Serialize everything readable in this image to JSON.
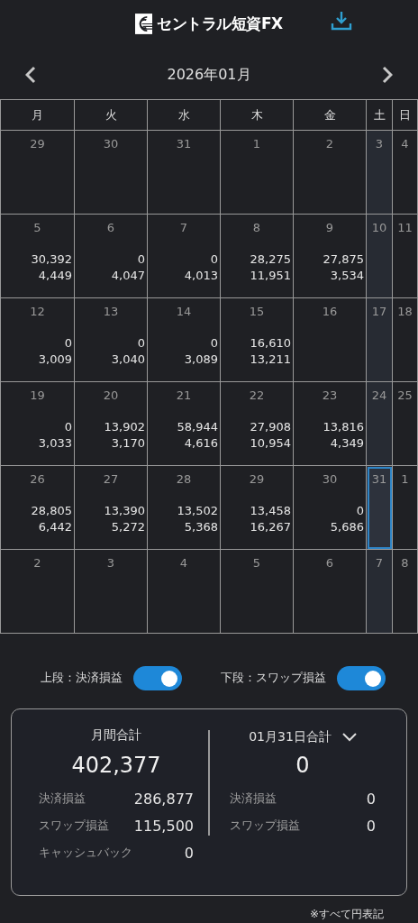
{
  "header": {
    "logo": "セントラル短資FX"
  },
  "month": {
    "title": "2026年01月"
  },
  "weekdays": [
    "月",
    "火",
    "水",
    "木",
    "金",
    "土",
    "日"
  ],
  "weeks": [
    [
      {
        "day": "29",
        "selected": false
      },
      {
        "day": "30",
        "selected": false
      },
      {
        "day": "31",
        "selected": false
      },
      {
        "day": "1",
        "selected": false
      },
      {
        "day": "2",
        "selected": false
      },
      {
        "day": "3",
        "selected": false
      },
      {
        "day": "4",
        "selected": false
      }
    ],
    [
      {
        "day": "5",
        "upper": "30,392",
        "lower": "4,449",
        "selected": false
      },
      {
        "day": "6",
        "upper": "0",
        "lower": "4,047",
        "selected": false
      },
      {
        "day": "7",
        "upper": "0",
        "lower": "4,013",
        "selected": false
      },
      {
        "day": "8",
        "upper": "28,275",
        "lower": "11,951",
        "selected": false
      },
      {
        "day": "9",
        "upper": "27,875",
        "lower": "3,534",
        "selected": false
      },
      {
        "day": "10",
        "selected": false
      },
      {
        "day": "11",
        "selected": false
      }
    ],
    [
      {
        "day": "12",
        "upper": "0",
        "lower": "3,009",
        "selected": false
      },
      {
        "day": "13",
        "upper": "0",
        "lower": "3,040",
        "selected": false
      },
      {
        "day": "14",
        "upper": "0",
        "lower": "3,089",
        "selected": false
      },
      {
        "day": "15",
        "upper": "16,610",
        "lower": "13,211",
        "selected": false
      },
      {
        "day": "16",
        "selected": false
      },
      {
        "day": "17",
        "selected": false
      },
      {
        "day": "18",
        "selected": false
      }
    ],
    [
      {
        "day": "19",
        "upper": "0",
        "lower": "3,033",
        "selected": false
      },
      {
        "day": "20",
        "upper": "13,902",
        "lower": "3,170",
        "selected": false
      },
      {
        "day": "21",
        "upper": "58,944",
        "lower": "4,616",
        "selected": false
      },
      {
        "day": "22",
        "upper": "27,908",
        "lower": "10,954",
        "selected": false
      },
      {
        "day": "23",
        "upper": "13,816",
        "lower": "4,349",
        "selected": false
      },
      {
        "day": "24",
        "selected": false
      },
      {
        "day": "25",
        "selected": false
      }
    ],
    [
      {
        "day": "26",
        "upper": "28,805",
        "lower": "6,442",
        "selected": false
      },
      {
        "day": "27",
        "upper": "13,390",
        "lower": "5,272",
        "selected": false
      },
      {
        "day": "28",
        "upper": "13,502",
        "lower": "5,368",
        "selected": false
      },
      {
        "day": "29",
        "upper": "13,458",
        "lower": "16,267",
        "selected": false
      },
      {
        "day": "30",
        "upper": "0",
        "lower": "5,686",
        "selected": false
      },
      {
        "day": "31",
        "selected": true
      },
      {
        "day": "1",
        "selected": false
      }
    ],
    [
      {
        "day": "2",
        "selected": false
      },
      {
        "day": "3",
        "selected": false
      },
      {
        "day": "4",
        "selected": false
      },
      {
        "day": "5",
        "selected": false
      },
      {
        "day": "6",
        "selected": false
      },
      {
        "day": "7",
        "selected": false
      },
      {
        "day": "8",
        "selected": false
      }
    ]
  ],
  "toggles": [
    {
      "label": "上段：決済損益",
      "on": true
    },
    {
      "label": "下段：スワップ損益",
      "on": true
    }
  ],
  "summary": {
    "monthly": {
      "title": "月間合計",
      "total": "402,377",
      "rows": [
        {
          "label": "決済損益",
          "value": "286,877"
        },
        {
          "label": "スワップ損益",
          "value": "115,500"
        },
        {
          "label": "キャッシュバック",
          "value": "0"
        }
      ]
    },
    "daily": {
      "title": "01月31日合計",
      "total": "0",
      "rows": [
        {
          "label": "決済損益",
          "value": "0"
        },
        {
          "label": "スワップ損益",
          "value": "0"
        }
      ]
    }
  },
  "footnote": "※すべて円表記"
}
